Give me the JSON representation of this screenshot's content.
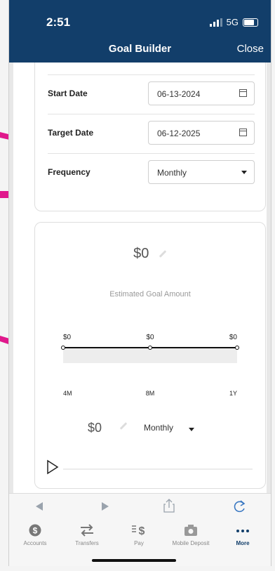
{
  "status": {
    "time": "2:51",
    "network": "5G"
  },
  "header": {
    "title": "Goal Builder",
    "close_label": "Close"
  },
  "form": {
    "start_date": {
      "label": "Start Date",
      "value": "06-13-2024"
    },
    "target_date": {
      "label": "Target Date",
      "value": "06-12-2025"
    },
    "frequency": {
      "label": "Frequency",
      "value": "Monthly"
    }
  },
  "goal": {
    "amount": "$0",
    "caption": "Estimated Goal Amount",
    "contribution_amount": "$0",
    "contribution_frequency": "Monthly"
  },
  "chart_data": {
    "type": "line",
    "categories": [
      "4M",
      "8M",
      "1Y"
    ],
    "values": [
      0,
      0,
      0
    ],
    "data_labels": [
      "$0",
      "$0",
      "$0"
    ]
  },
  "tabs": [
    {
      "label": "Accounts",
      "icon": "dollar-circle-icon"
    },
    {
      "label": "Transfers",
      "icon": "arrows-transfer-icon"
    },
    {
      "label": "Pay",
      "icon": "pay-icon"
    },
    {
      "label": "Mobile Deposit",
      "icon": "camera-icon"
    },
    {
      "label": "More",
      "icon": "more-dots-icon"
    }
  ],
  "colors": {
    "header": "#123e6a",
    "annotation": "#e0198c"
  }
}
